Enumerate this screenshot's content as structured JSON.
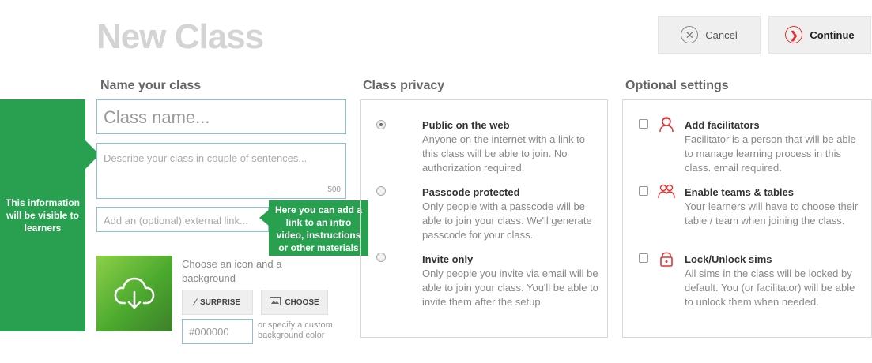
{
  "page": {
    "title": "New Class"
  },
  "toolbar": {
    "cancel_label": "Cancel",
    "continue_label": "Continue"
  },
  "name_section": {
    "heading": "Name your class",
    "name_placeholder": "Class name...",
    "desc_placeholder": "Describe your class in couple of sentences...",
    "desc_counter": "500",
    "link_placeholder": "Add an (optional) external link...",
    "visible_note": "This information will be visible to learners",
    "link_tip": "Here you can add a link to an intro video, instructions or other materials",
    "icon_label": "Choose an icon and a background",
    "surprise_label": "SURPRISE",
    "choose_label": "CHOOSE",
    "color_placeholder": "#000000",
    "custom_color_note": "or specify a custom background color"
  },
  "privacy": {
    "heading": "Class privacy",
    "options": [
      {
        "title": "Public on the web",
        "desc": "Anyone on the internet with a link to this class will be able to join. No authorization required.",
        "selected": true
      },
      {
        "title": "Passcode protected",
        "desc": "Only people with a passcode will be able to join your class. We'll generate passcode for your class.",
        "selected": false
      },
      {
        "title": "Invite only",
        "desc": "Only people you invite via email will be able to join your class. You'll be able to invite them after the setup.",
        "selected": false
      }
    ]
  },
  "optional": {
    "heading": "Optional settings",
    "items": [
      {
        "icon": "facilitator-icon",
        "title": "Add facilitators",
        "desc": "Facilitator is a person that will be able to manage learning process in this class. email required."
      },
      {
        "icon": "teams-icon",
        "title": "Enable teams & tables",
        "desc": "Your learners will have to choose their table / team when joining the class."
      },
      {
        "icon": "lock-icon",
        "title": "Lock/Unlock sims",
        "desc": "All sims in the class will be locked by default. You (or facilitator) will be able to unlock them when needed."
      }
    ]
  },
  "colors": {
    "accent_green": "#28a050",
    "accent_red": "#e23030",
    "input_border": "#8cc2dc"
  }
}
